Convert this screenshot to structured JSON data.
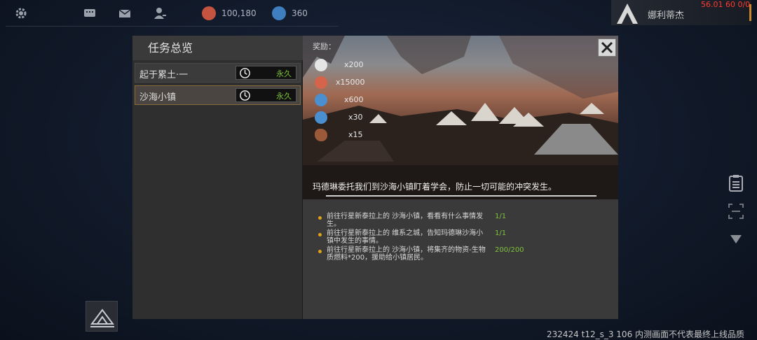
{
  "hud": {
    "resource_1": "100,180",
    "resource_2": "360",
    "player_name": "娜利蒂杰",
    "fps": "56.01 60 0/0",
    "watermark": "232424 t12_s_3 106  内测画面不代表最终上线品质"
  },
  "panel": {
    "title": "任务总览",
    "quests": [
      {
        "name": "起于累土·一",
        "duration": "永久"
      },
      {
        "name": "沙海小镇",
        "duration": "永久"
      }
    ],
    "selected_index": 1
  },
  "detail": {
    "reward_label": "奖励：",
    "rewards": [
      {
        "icon": "badge-icon",
        "count": "x200"
      },
      {
        "icon": "orange-coin-icon",
        "count": "x15000"
      },
      {
        "icon": "blue-crystal-icon",
        "count": "x600"
      },
      {
        "icon": "blue-crystal-icon",
        "count": "x30"
      },
      {
        "icon": "ore-icon",
        "count": "x15"
      }
    ],
    "description": "玛德琳委托我们到沙海小镇盯着学会，防止一切可能的冲突发生。",
    "objectives": [
      {
        "text": "前往行星新泰拉上的 沙海小镇，看看有什么事情发生。",
        "progress": "1/1"
      },
      {
        "text": "前往行星新泰拉上的 维系之城，告知玛德琳沙海小镇中发生的事情。",
        "progress": "1/1"
      },
      {
        "text": "前往行星新泰拉上的 沙海小镇，将集齐的物资-生物质燃料*200，援助给小镇居民。",
        "progress": "200/200"
      }
    ]
  },
  "colors": {
    "accent_orange": "#c8872f",
    "progress_green": "#7ec23a",
    "bullet_yellow": "#e0a21a",
    "fps_red": "#ff3b30"
  }
}
